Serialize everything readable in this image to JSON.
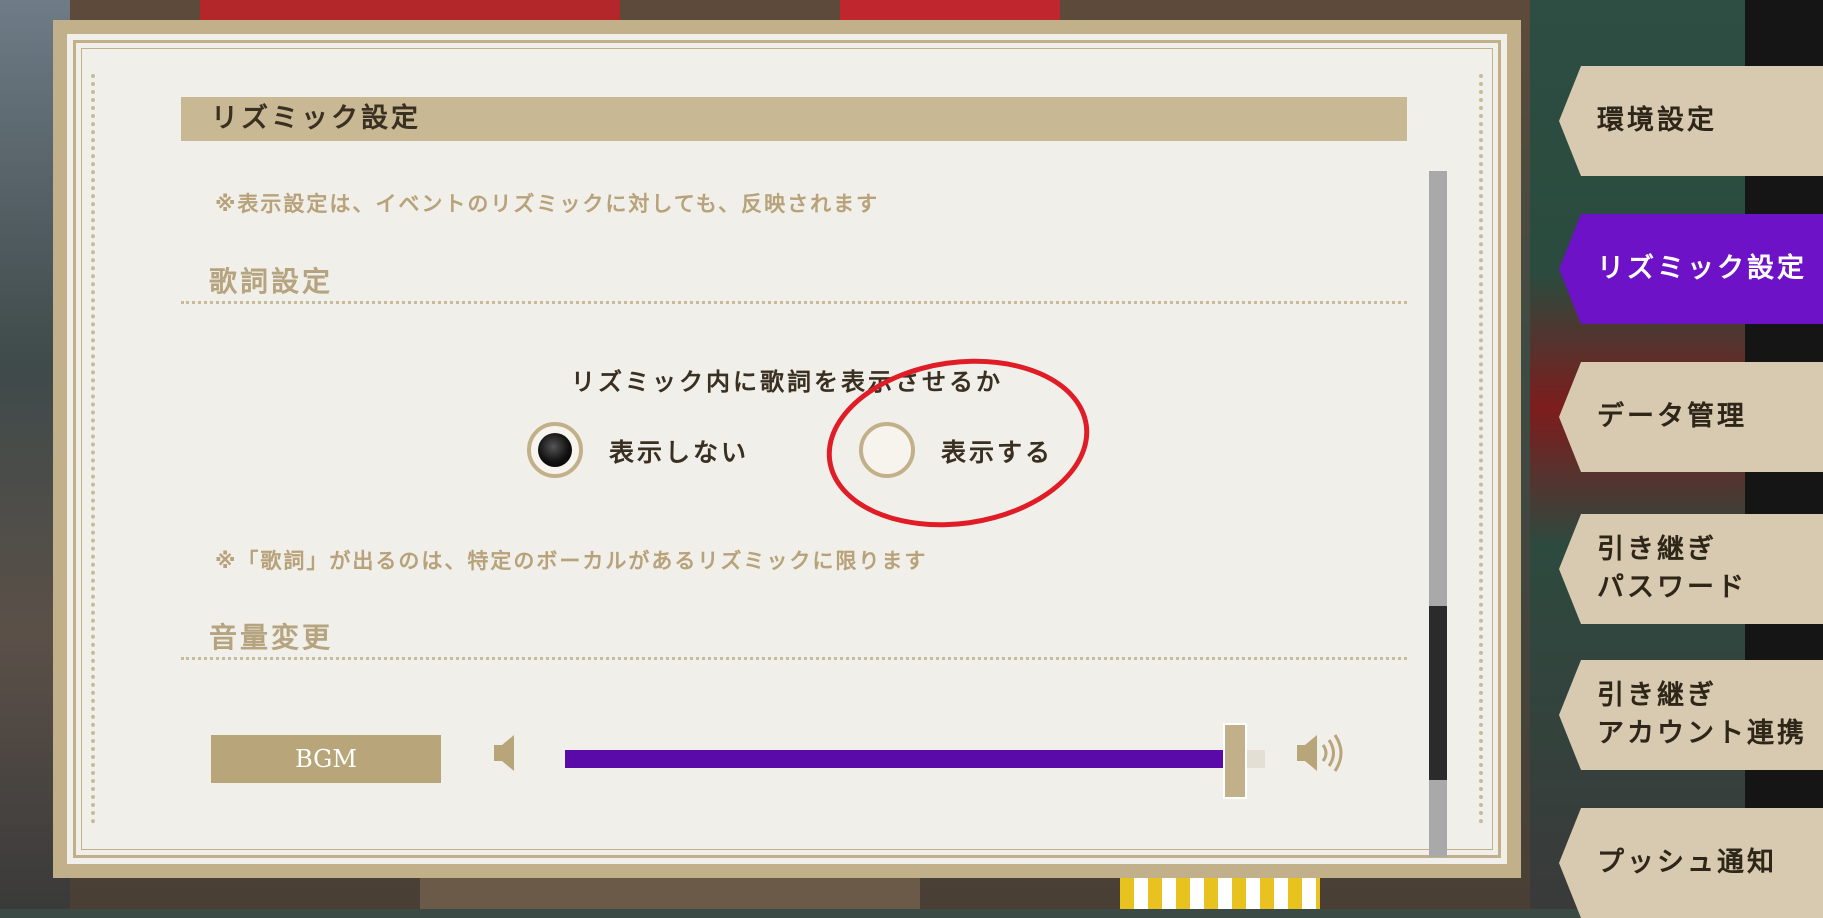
{
  "section": {
    "title": "リズミック設定",
    "note_top": "※表示設定は、イベントのリズミックに対しても、反映されます"
  },
  "lyrics": {
    "heading": "歌詞設定",
    "question": "リズミック内に歌詞を表示させるか",
    "options": [
      "表示しない",
      "表示する"
    ],
    "selected": "表示しない",
    "note": "※「歌詞」が出るのは、特定のボーカルがあるリズミックに限ります"
  },
  "volume": {
    "heading": "音量変更",
    "bgm_label": "BGM",
    "bgm_level": 1.0,
    "low_icon": "speaker-low-icon",
    "high_icon": "speaker-high-icon"
  },
  "tabs": [
    {
      "label": "環境設定",
      "active": false
    },
    {
      "label": "リズミック設定",
      "active": true
    },
    {
      "label": "データ管理",
      "active": false
    },
    {
      "label": "引き継ぎ\nパスワード",
      "active": false
    },
    {
      "label": "引き継ぎ\nアカウント連携",
      "active": false
    },
    {
      "label": "プッシュ通知",
      "active": false
    }
  ],
  "colors": {
    "accent": "#6d12c6",
    "slider_fill": "#5a0aa8",
    "panel_border": "#c2b08a",
    "annotation": "#e01c26"
  }
}
